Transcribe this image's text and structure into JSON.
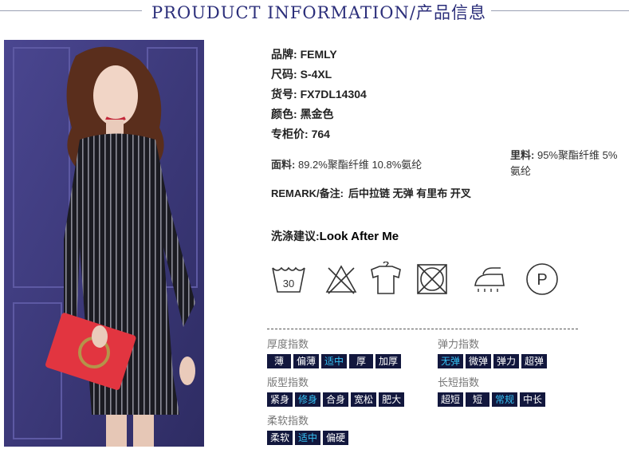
{
  "header": {
    "title": "PROUDUCT INFORMATION/产品信息"
  },
  "specs": [
    {
      "label": "品牌:",
      "value": "FEMLY"
    },
    {
      "label": "尺码:",
      "value": "S-4XL"
    },
    {
      "label": "货号:",
      "value": "FX7DL14304"
    },
    {
      "label": "颜色:",
      "value": "黑金色"
    },
    {
      "label": "专柜价:",
      "value": "764"
    }
  ],
  "fabric": {
    "label": "面料:",
    "value": "89.2%聚酯纤维 10.8%氨纶"
  },
  "lining": {
    "label": "里料:",
    "value": "95%聚酯纤维 5%氨纶"
  },
  "remark": {
    "label": "REMARK/备注:",
    "value": "后中拉链 无弹 有里布 开叉"
  },
  "wash": {
    "label": "洗涤建议:",
    "value": "Look After Me"
  },
  "care_icons": [
    {
      "name": "wash-30-icon",
      "text": "30"
    },
    {
      "name": "no-bleach-icon"
    },
    {
      "name": "hang-dry-icon"
    },
    {
      "name": "no-tumble-dry-icon"
    },
    {
      "name": "iron-steam-icon"
    },
    {
      "name": "dry-clean-p-icon",
      "text": "P"
    }
  ],
  "indices": {
    "thickness": {
      "label": "厚度指数",
      "options": [
        "薄",
        "偏薄",
        "适中",
        "厚",
        "加厚"
      ],
      "selected": "适中"
    },
    "elasticity": {
      "label": "弹力指数",
      "options": [
        "无弹",
        "微弹",
        "弹力",
        "超弹"
      ],
      "selected": "无弹"
    },
    "fit": {
      "label": "版型指数",
      "options": [
        "紧身",
        "修身",
        "合身",
        "宽松",
        "肥大"
      ],
      "selected": "修身"
    },
    "length": {
      "label": "长短指数",
      "options": [
        "超短",
        "短",
        "常规",
        "中长"
      ],
      "selected": "常规"
    },
    "softness": {
      "label": "柔软指数",
      "options": [
        "柔软",
        "适中",
        "偏硬"
      ],
      "selected": "适中"
    }
  },
  "colors": {
    "chip_bg": "#12173d",
    "chip_active": "#35c2f5",
    "title": "#2b2e7a"
  }
}
